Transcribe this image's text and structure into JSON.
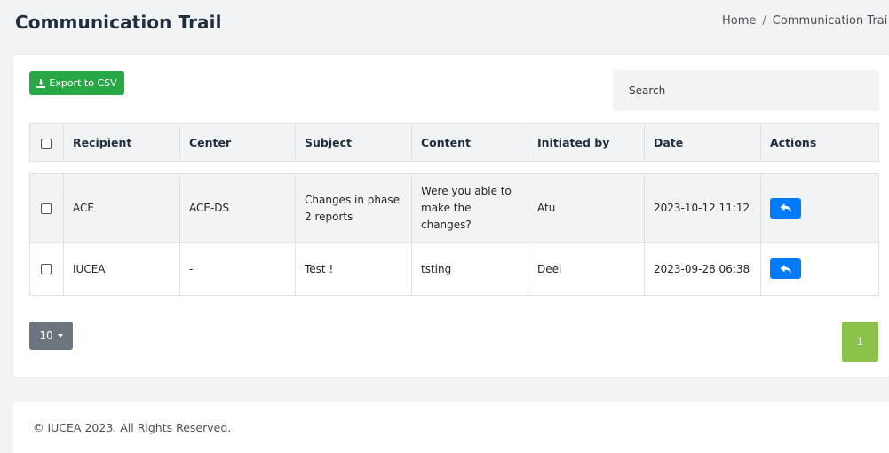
{
  "header": {
    "title": "Communication Trail",
    "breadcrumb": {
      "home": "Home",
      "separator": "/",
      "current": "Communication Trai"
    }
  },
  "toolbar": {
    "export_label": "Export to CSV",
    "export_icon": "download-icon",
    "search_placeholder": "Search"
  },
  "table": {
    "columns": [
      "Recipient",
      "Center",
      "Subject",
      "Content",
      "Initiated by",
      "Date",
      "Actions"
    ],
    "rows": [
      {
        "recipient": "ACE",
        "center": "ACE-DS",
        "subject": "Changes in phase 2 reports",
        "content": "Were you able to make the changes?",
        "initiated_by": "Atu",
        "date": "2023-10-12 11:12",
        "action_icon": "reply-icon"
      },
      {
        "recipient": "IUCEA",
        "center": "-",
        "subject": "Test !",
        "content": "tsting",
        "initiated_by": "Deel",
        "date": "2023-09-28 06:38",
        "action_icon": "reply-icon"
      }
    ]
  },
  "pagination": {
    "page_size": "10",
    "current_page": "1"
  },
  "footer": {
    "copyright": "© IUCEA 2023. All Rights Reserved."
  },
  "colors": {
    "export_button": "#28a745",
    "reply_button": "#007bff",
    "page_size_button": "#6c757d",
    "active_page": "#8bc34a",
    "background": "#f2f3f5"
  }
}
